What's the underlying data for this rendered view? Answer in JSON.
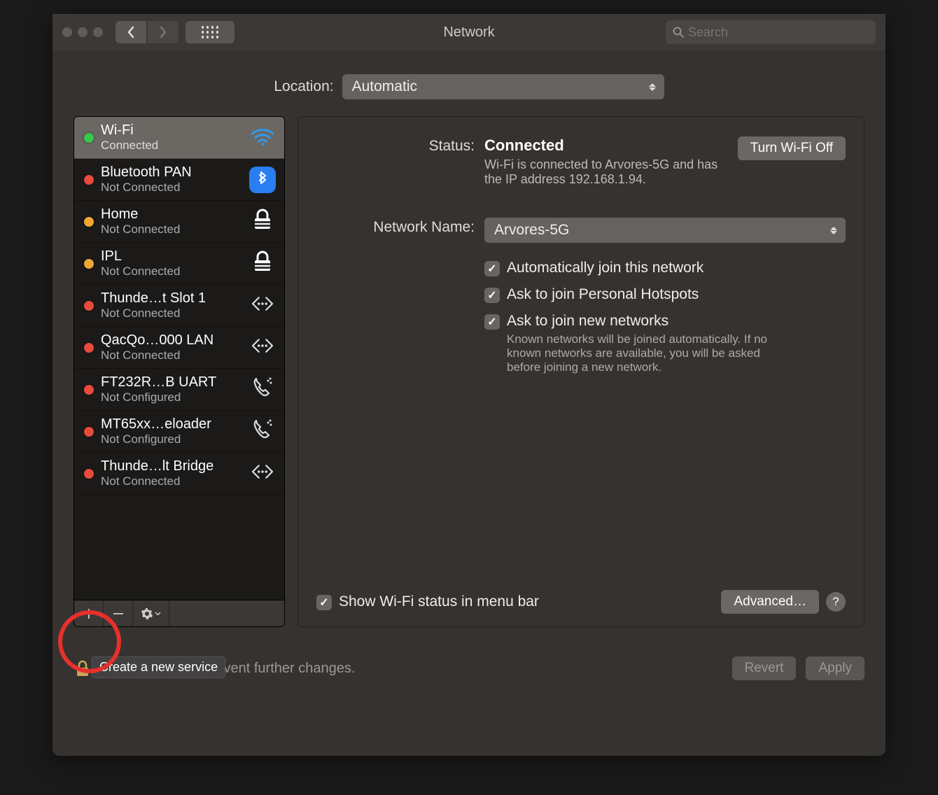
{
  "window": {
    "title": "Network",
    "search_placeholder": "Search"
  },
  "location": {
    "label": "Location:",
    "value": "Automatic"
  },
  "services": [
    {
      "name": "Wi-Fi",
      "status": "Connected",
      "dot": "green",
      "icon": "wifi",
      "selected": true
    },
    {
      "name": "Bluetooth PAN",
      "status": "Not Connected",
      "dot": "red",
      "icon": "bluetooth"
    },
    {
      "name": "Home",
      "status": "Not Connected",
      "dot": "orange",
      "icon": "lock"
    },
    {
      "name": "IPL",
      "status": "Not Connected",
      "dot": "orange",
      "icon": "lock"
    },
    {
      "name": "Thunde…t Slot  1",
      "status": "Not Connected",
      "dot": "red",
      "icon": "ethernet"
    },
    {
      "name": "QacQo…000 LAN",
      "status": "Not Connected",
      "dot": "red",
      "icon": "ethernet"
    },
    {
      "name": "FT232R…B UART",
      "status": "Not Configured",
      "dot": "red",
      "icon": "phone"
    },
    {
      "name": "MT65xx…eloader",
      "status": "Not Configured",
      "dot": "red",
      "icon": "phone"
    },
    {
      "name": "Thunde…lt Bridge",
      "status": "Not Connected",
      "dot": "red",
      "icon": "ethernet"
    }
  ],
  "sidebar_tooltip": "Create a new service",
  "detail": {
    "status_label": "Status:",
    "status_value": "Connected",
    "status_desc": "Wi-Fi is connected to Arvores-5G and has the IP address 192.168.1.94.",
    "wifi_toggle": "Turn Wi-Fi Off",
    "network_name_label": "Network Name:",
    "network_name_value": "Arvores-5G",
    "auto_join": "Automatically join this network",
    "ask_hotspot": "Ask to join Personal Hotspots",
    "ask_new": "Ask to join new networks",
    "ask_new_hint": "Known networks will be joined automatically. If no known networks are available, you will be asked before joining a new network.",
    "show_menu_bar": "Show Wi-Fi status in menu bar",
    "advanced": "Advanced…"
  },
  "footer": {
    "lock_text": "Click the lock to prevent further changes.",
    "revert": "Revert",
    "apply": "Apply"
  }
}
